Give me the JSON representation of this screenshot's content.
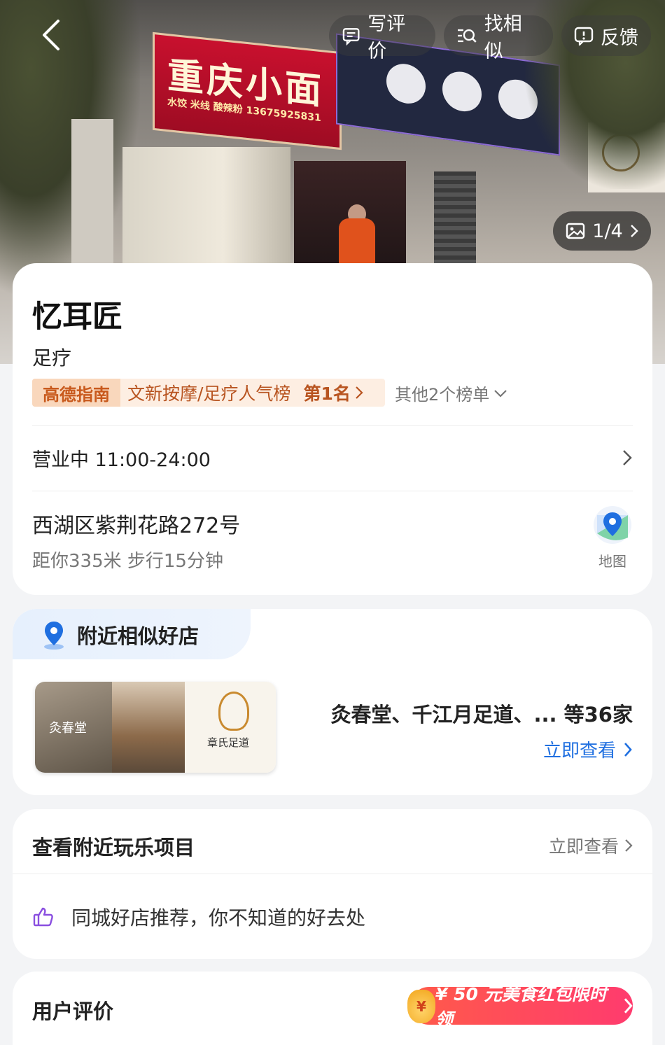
{
  "hero": {
    "photo_counter": "1/4",
    "actions": {
      "review_label": "写评价",
      "similar_label": "找相似",
      "feedback_label": "反馈"
    }
  },
  "shop": {
    "name": "忆耳匠",
    "category": "足疗",
    "ranking": {
      "badge": "高德指南",
      "list_name": "文新按摩/足疗人气榜",
      "position": "第1名",
      "other_lists": "其他2个榜单"
    },
    "hours": "营业中  11:00-24:00",
    "address": "西湖区紫荆花路272号",
    "distance": "距你335米   步行15分钟",
    "map_label": "地图"
  },
  "nearby": {
    "title": "附近相似好店",
    "image_labels": [
      "灸春堂",
      "章氏足道"
    ],
    "shops_summary": "灸春堂、千江月足道、... 等36家",
    "view_label": "立即查看"
  },
  "play": {
    "title": "查看附近玩乐项目",
    "view_label": "立即查看",
    "recommend_text": "同城好店推荐，你不知道的好去处"
  },
  "reviews": {
    "title": "用户评价",
    "coupon_text": "¥ 50 元美食红包限时领",
    "coupon_icon_glyph": "¥"
  },
  "colors": {
    "accent_blue": "#1f6fe0",
    "rank_orange": "#c8591c",
    "coupon_red": "#ff3b6e",
    "thumb_purple": "#8a4fe0"
  }
}
